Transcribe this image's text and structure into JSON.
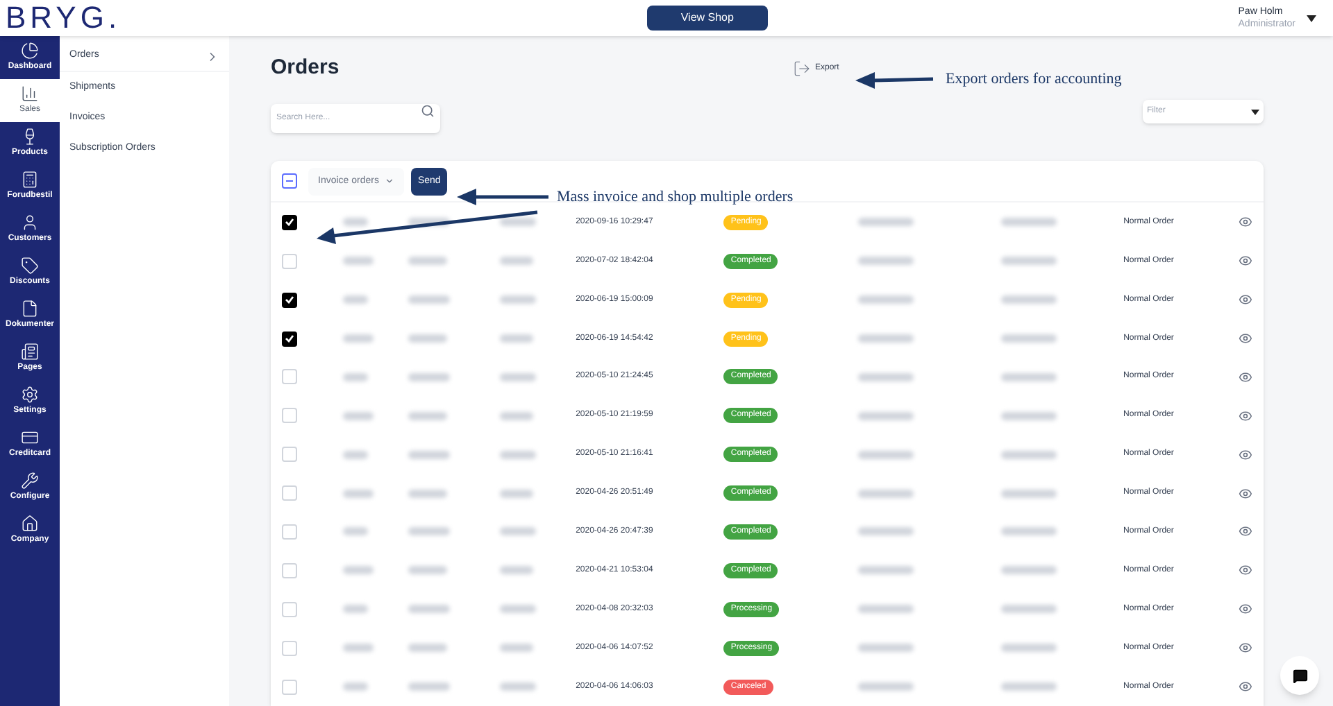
{
  "header": {
    "logo": "BRYG.",
    "view_shop_button": "View Shop",
    "user": {
      "name": "Paw Holm",
      "role": "Administrator"
    }
  },
  "sidebar": {
    "items": [
      {
        "label": "Dashboard",
        "selected": false
      },
      {
        "label": "Sales",
        "selected": true
      },
      {
        "label": "Products",
        "selected": false
      },
      {
        "label": "Forudbestil",
        "selected": false
      },
      {
        "label": "Customers",
        "selected": false
      },
      {
        "label": "Discounts",
        "selected": false
      },
      {
        "label": "Dokumenter",
        "selected": false
      },
      {
        "label": "Pages",
        "selected": false
      },
      {
        "label": "Settings",
        "selected": false
      },
      {
        "label": "Creditcard",
        "selected": false
      },
      {
        "label": "Configure",
        "selected": false
      },
      {
        "label": "Company",
        "selected": false
      }
    ]
  },
  "subnav": {
    "items": [
      {
        "label": "Orders",
        "selected": true
      },
      {
        "label": "Shipments",
        "selected": false
      },
      {
        "label": "Invoices",
        "selected": false
      },
      {
        "label": "Subscription Orders",
        "selected": false
      }
    ]
  },
  "page": {
    "title": "Orders",
    "export_button": "Export",
    "search": {
      "placeholder": "Search Here..."
    },
    "filter": {
      "placeholder": "Filter"
    }
  },
  "toolbar": {
    "select_all": {
      "indeterminate": true
    },
    "action_select": "Invoice orders",
    "send_button": "Send"
  },
  "rows": [
    {
      "checked": true,
      "date": "2020-09-16 10:29:47",
      "status": "Pending",
      "color": "#ffc21a",
      "type": "Normal Order"
    },
    {
      "checked": false,
      "date": "2020-07-02 18:42:04",
      "status": "Completed",
      "color": "#43a443",
      "type": "Normal Order"
    },
    {
      "checked": true,
      "date": "2020-06-19 15:00:09",
      "status": "Pending",
      "color": "#ffc21a",
      "type": "Normal Order"
    },
    {
      "checked": true,
      "date": "2020-06-19 14:54:42",
      "status": "Pending",
      "color": "#ffc21a",
      "type": "Normal Order"
    },
    {
      "checked": false,
      "date": "2020-05-10 21:24:45",
      "status": "Completed",
      "color": "#43a443",
      "type": "Normal Order"
    },
    {
      "checked": false,
      "date": "2020-05-10 21:19:59",
      "status": "Completed",
      "color": "#43a443",
      "type": "Normal Order"
    },
    {
      "checked": false,
      "date": "2020-05-10 21:16:41",
      "status": "Completed",
      "color": "#43a443",
      "type": "Normal Order"
    },
    {
      "checked": false,
      "date": "2020-04-26 20:51:49",
      "status": "Completed",
      "color": "#43a443",
      "type": "Normal Order"
    },
    {
      "checked": false,
      "date": "2020-04-26 20:47:39",
      "status": "Completed",
      "color": "#43a443",
      "type": "Normal Order"
    },
    {
      "checked": false,
      "date": "2020-04-21 10:53:04",
      "status": "Completed",
      "color": "#43a443",
      "type": "Normal Order"
    },
    {
      "checked": false,
      "date": "2020-04-08 20:32:03",
      "status": "Processing",
      "color": "#43a443",
      "type": "Normal Order"
    },
    {
      "checked": false,
      "date": "2020-04-06 14:07:52",
      "status": "Processing",
      "color": "#43a443",
      "type": "Normal Order"
    },
    {
      "checked": false,
      "date": "2020-04-06 14:06:03",
      "status": "Canceled",
      "color": "#f25a5a",
      "type": "Normal Order"
    }
  ],
  "annotations": [
    {
      "text": "Export orders for accounting"
    },
    {
      "text": "Mass invoice and shop multiple orders"
    }
  ]
}
